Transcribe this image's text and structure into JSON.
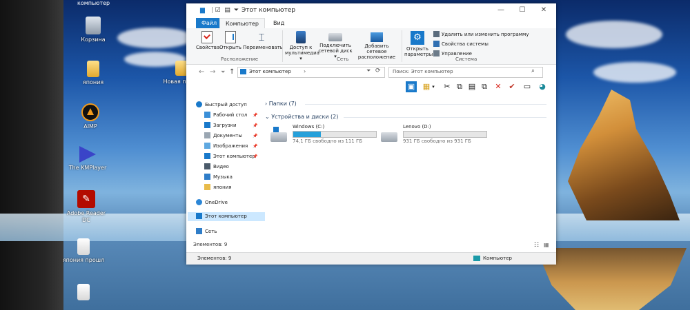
{
  "desktop": {
    "top_label": "компьютер",
    "icons": [
      {
        "label": "Корзина"
      },
      {
        "label": "япония"
      },
      {
        "label": "AIMP"
      },
      {
        "label": "The KMPlayer"
      },
      {
        "label": "Adobe Reader DC"
      },
      {
        "label": "япония прошл"
      },
      {
        "label": "Новая папка"
      }
    ]
  },
  "window": {
    "title": "Этот компьютер",
    "tabs": [
      "Файл",
      "Компьютер",
      "Вид"
    ],
    "ribbon": {
      "location_group": {
        "label": "Расположение",
        "buttons": [
          "Свойства",
          "Открыть",
          "Переименовать"
        ]
      },
      "network_group": {
        "label": "Сеть",
        "buttons": [
          "Доступ к мультимедиа",
          "Подключить сетевой диск",
          "Добавить сетевое расположение"
        ]
      },
      "system_group": {
        "label": "Система",
        "open_settings": "Открыть параметры",
        "items": [
          "Удалить или изменить программу",
          "Свойства системы",
          "Управление"
        ]
      }
    },
    "address": "Этот компьютер",
    "search_placeholder": "Поиск: Этот компьютер",
    "nav": [
      {
        "label": "Быстрый доступ"
      },
      {
        "label": "Рабочий стол"
      },
      {
        "label": "Загрузки"
      },
      {
        "label": "Документы"
      },
      {
        "label": "Изображения"
      },
      {
        "label": "Этот компьютер"
      },
      {
        "label": "Видео"
      },
      {
        "label": "Музыка"
      },
      {
        "label": "япония"
      },
      {
        "label": "OneDrive"
      },
      {
        "label": "Этот компьютер"
      },
      {
        "label": "Сеть"
      }
    ],
    "sections": {
      "folders": "Папки (7)",
      "devices": "Устройства и диски (2)"
    },
    "drives": [
      {
        "name": "Windows (C:)",
        "free": "74,1 ГБ свободно из 111 ГБ",
        "used_fraction": 0.33
      },
      {
        "name": "Lenovo (D:)",
        "free": "931 ГБ свободно из 931 ГБ",
        "used_fraction": 0.0
      }
    ],
    "inner_status": "Элементов: 9",
    "status_count": "Элементов: 9",
    "status_location": "Компьютер"
  },
  "colors": {
    "accent": "#1979ca",
    "drive_fill": "#26a0da",
    "delete_red": "#d9261c",
    "check_red": "#c0392b"
  }
}
